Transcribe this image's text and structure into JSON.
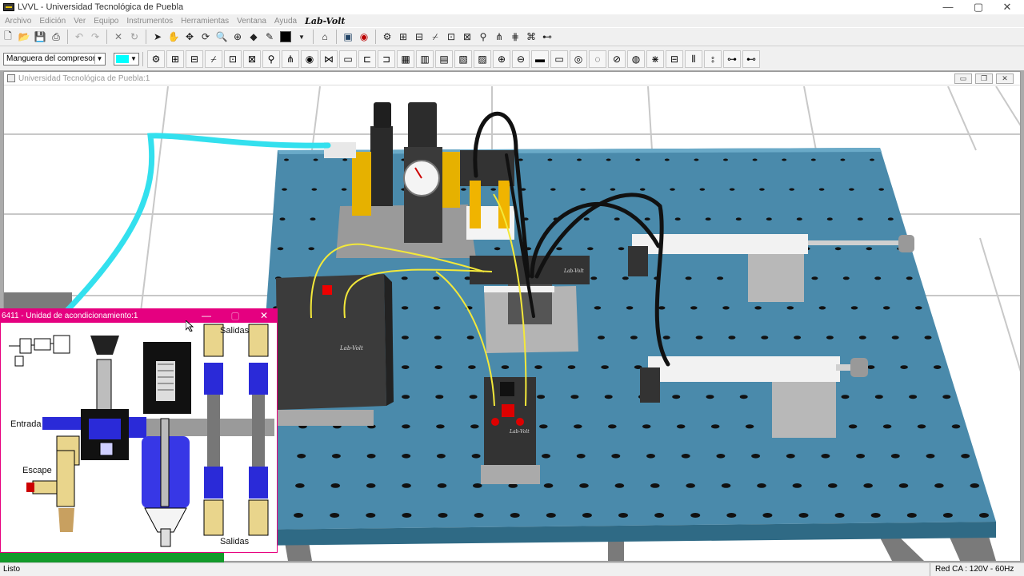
{
  "window": {
    "title": "LVVL - Universidad Tecnológica de Puebla",
    "minimize": "—",
    "maximize": "▢",
    "close": "✕"
  },
  "menu": {
    "items": [
      "Archivo",
      "Edición",
      "Ver",
      "Equipo",
      "Instrumentos",
      "Herramientas",
      "Ventana",
      "Ayuda"
    ],
    "logo": "Lab-Volt"
  },
  "toolbar": {
    "component_select": "Manguera del compresor",
    "color_selected": "#00ffff"
  },
  "child_window": {
    "title": "Universidad Tecnológica de Puebla:1"
  },
  "panel": {
    "title": "6411 - Unidad de acondicionamiento:1",
    "labels": {
      "salidas_top": "Salidas",
      "entrada": "Entrada",
      "escape": "Escape",
      "salidas_bottom": "Salidas"
    }
  },
  "status": {
    "left": "Listo",
    "right": "Red CA : 120V - 60Hz"
  },
  "colors": {
    "panel_accent": "#e50080",
    "table_blue": "#4a8aab",
    "hose": "#33e0ee",
    "wire": "#f3e83a"
  }
}
